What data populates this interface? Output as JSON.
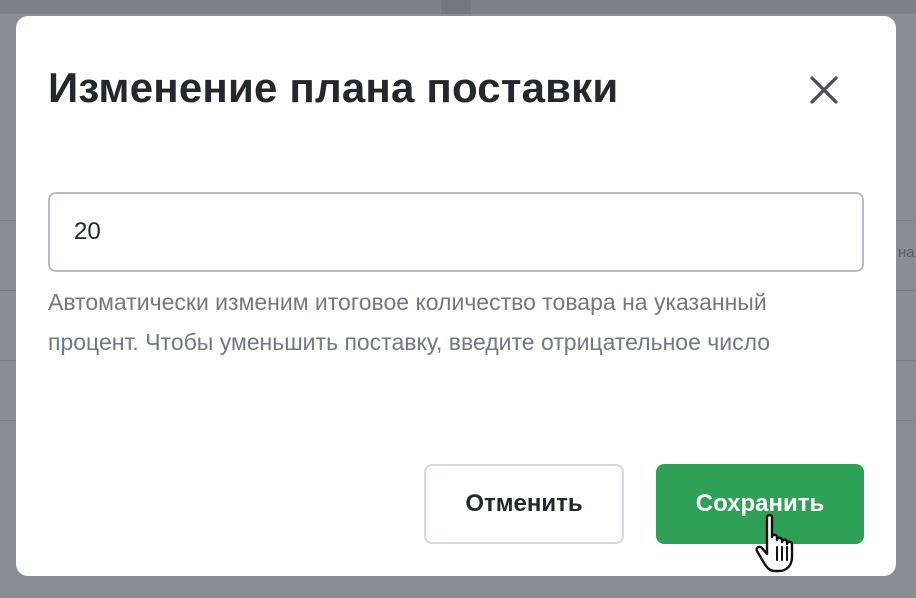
{
  "dialog": {
    "title": "Изменение плана поставки",
    "input_value": "20",
    "helper_text": "Автоматически изменим итоговое количество товара на указанный процент. Чтобы уменьшить поставку, введите отрицательное число",
    "cancel_label": "Отменить",
    "save_label": "Сохранить"
  },
  "background": {
    "fragment_text": "на"
  },
  "colors": {
    "primary": "#2ea157",
    "title": "#24272b",
    "helper": "#737880",
    "input_border": "#b8bcc2"
  },
  "icons": {
    "close": "close-icon",
    "cursor": "hand-pointer-cursor"
  }
}
